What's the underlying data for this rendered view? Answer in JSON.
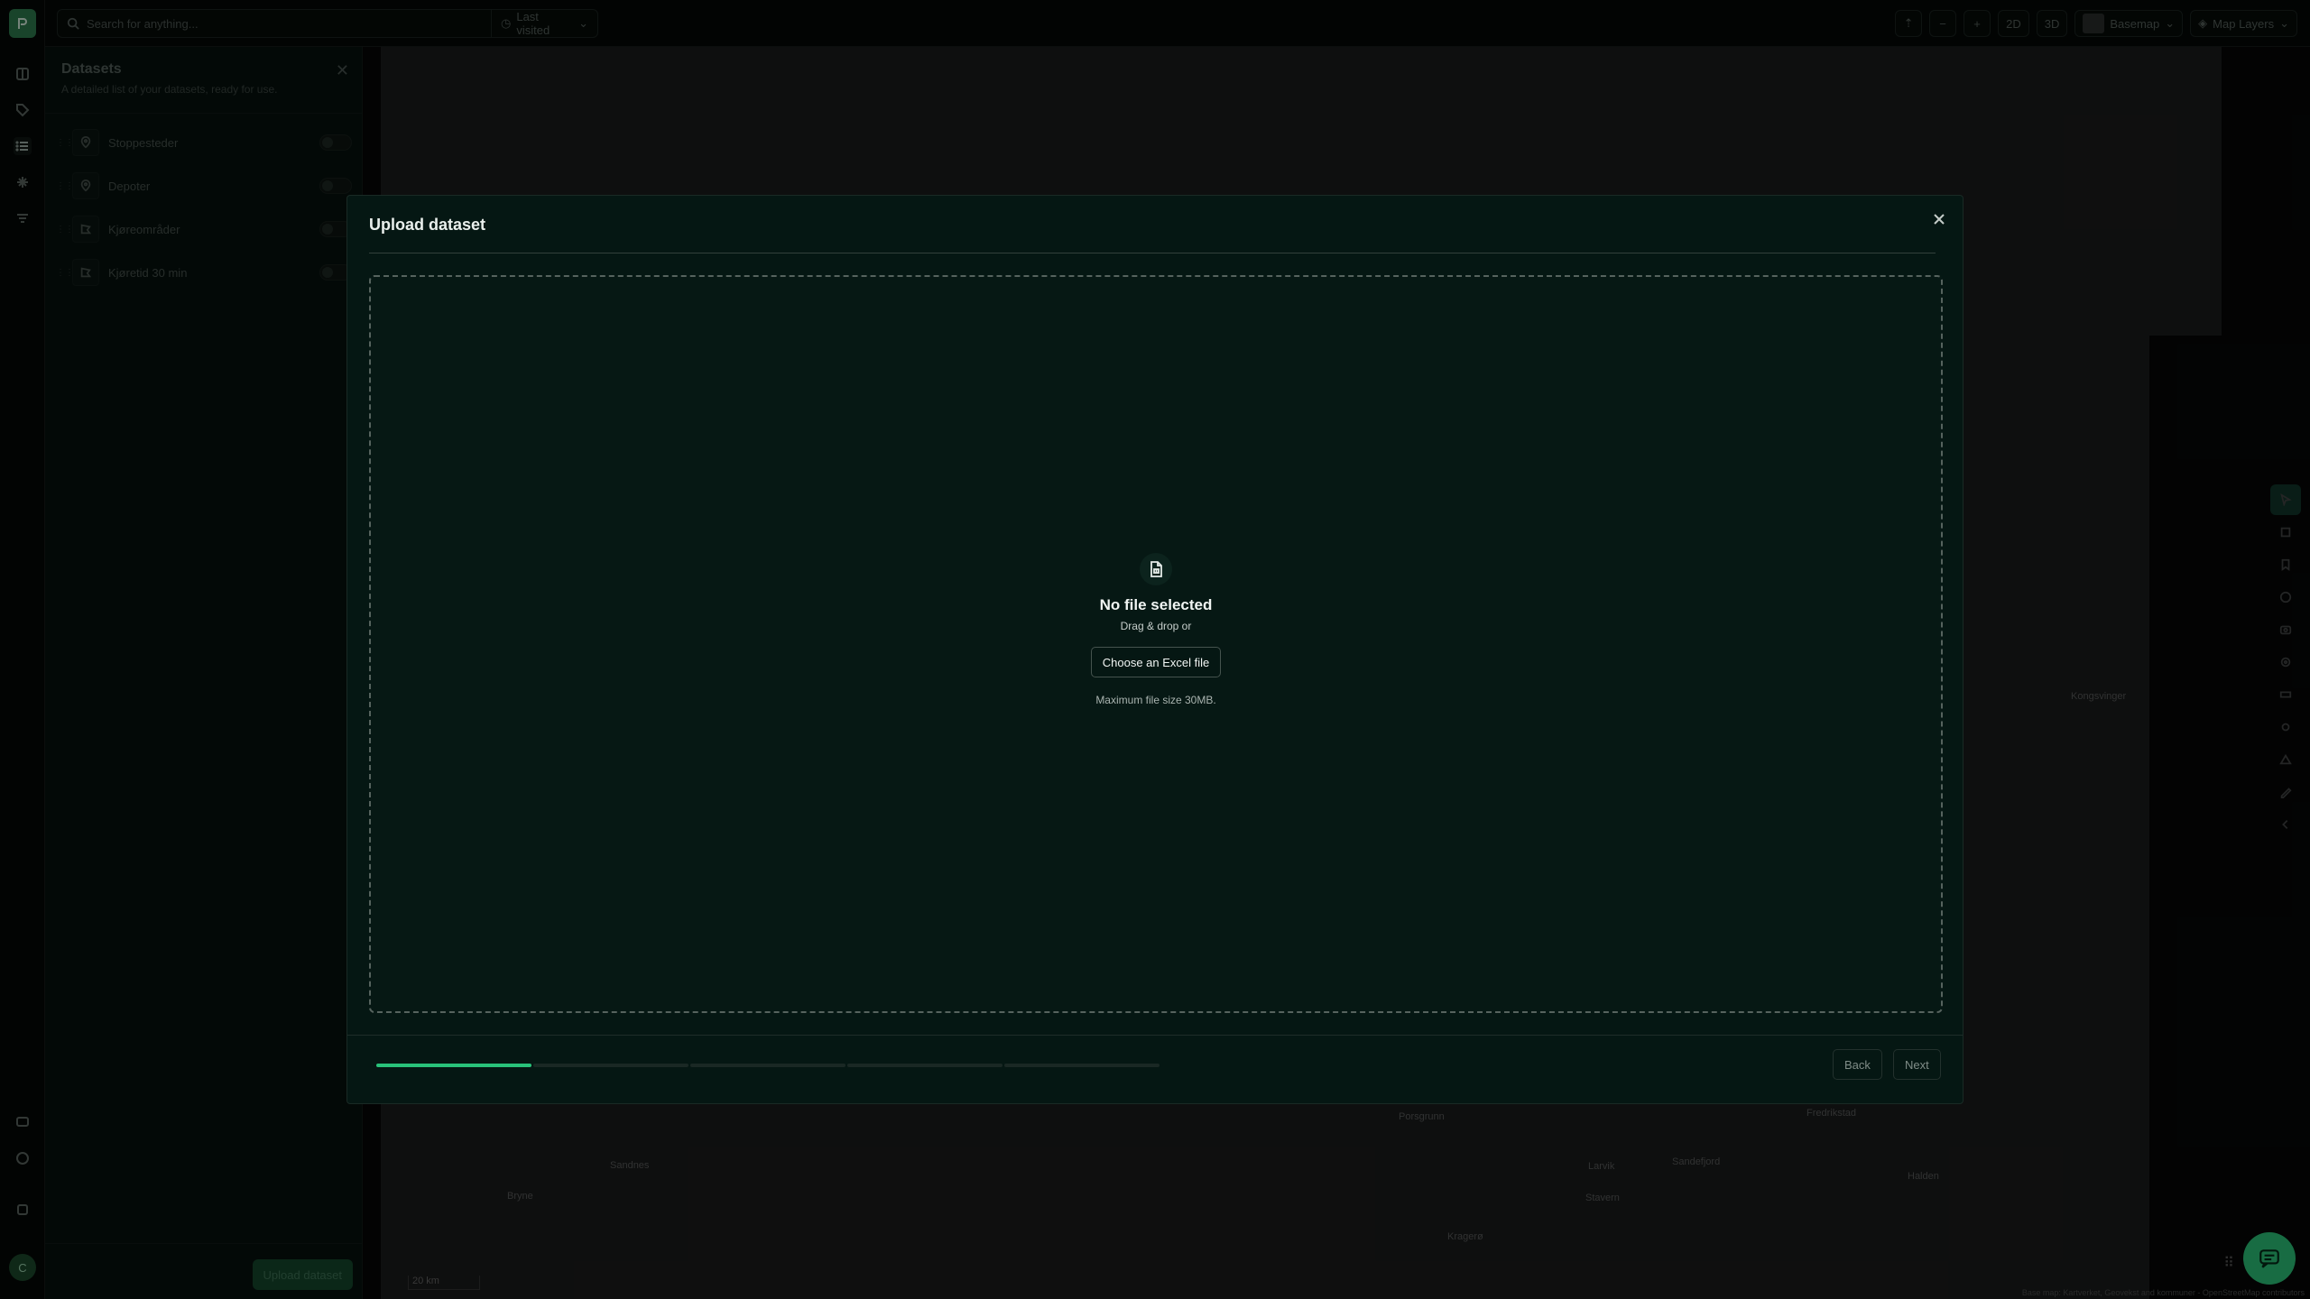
{
  "topbar": {
    "search_placeholder": "Search for anything...",
    "last_visited": "Last visited",
    "zoom_out": "−",
    "zoom_in": "+",
    "view_2d": "2D",
    "view_3d": "3D",
    "basemap": "Basemap",
    "map_layers": "Map Layers"
  },
  "rail": {
    "avatar_initial": "C"
  },
  "panel": {
    "title": "Datasets",
    "subtitle": "A detailed list of your datasets, ready for use.",
    "items": [
      {
        "label": "Stoppesteder",
        "icon": "map-pin-icon"
      },
      {
        "label": "Depoter",
        "icon": "map-pin-icon"
      },
      {
        "label": "Kjøreområder",
        "icon": "polygon-icon"
      },
      {
        "label": "Kjøretid 30 min",
        "icon": "polygon-icon"
      }
    ],
    "upload_label": "Upload dataset"
  },
  "map": {
    "scale_label": "20 km",
    "attribution": "Base map: Kartverket, Geovekst and kommuner - OpenStreetMap contributors",
    "towns": [
      {
        "name": "Sandefjord"
      },
      {
        "name": "Larvik"
      },
      {
        "name": "Stavern"
      },
      {
        "name": "Kragerø"
      },
      {
        "name": "Porsgrunn"
      },
      {
        "name": "Bryne"
      },
      {
        "name": "Sandnes"
      },
      {
        "name": "Kongsvinger"
      },
      {
        "name": "Halden"
      },
      {
        "name": "Fredrikstad"
      }
    ]
  },
  "modal": {
    "title": "Upload dataset",
    "no_file": "No file selected",
    "drag_drop": "Drag & drop or",
    "choose_label": "Choose an Excel file",
    "max_size": "Maximum file size 30MB.",
    "back_label": "Back",
    "next_label": "Next",
    "steps_total": 5,
    "steps_completed": 1
  },
  "colors": {
    "accent": "#29c27a",
    "modal_bg": "#051713",
    "map_bg": "#1b1c1c"
  }
}
